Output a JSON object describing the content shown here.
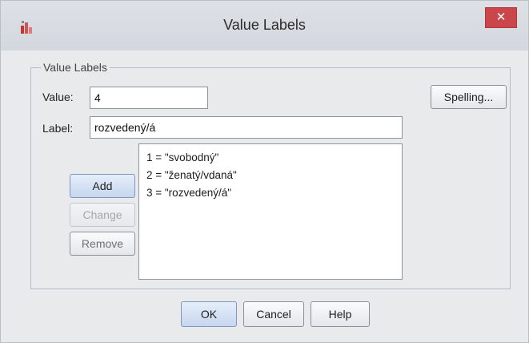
{
  "window": {
    "title": "Value Labels",
    "close_glyph": "✕"
  },
  "group": {
    "legend": "Value Labels"
  },
  "value_field": {
    "label": "Value:",
    "value": "4"
  },
  "label_field": {
    "label": "Label:",
    "value": "rozvedený/á"
  },
  "buttons": {
    "spelling": "Spelling...",
    "add": "Add",
    "change": "Change",
    "remove": "Remove",
    "ok": "OK",
    "cancel": "Cancel",
    "help": "Help"
  },
  "list": {
    "items": [
      "1 = \"svobodný\"",
      "2 = \"ženatý/vdaná\"",
      "3 = \"rozvedený/á\""
    ]
  },
  "colors": {
    "close": "#c9474a",
    "accent_button": "#c6d6ee"
  },
  "icons": {
    "app": "spss-value-labels-icon",
    "close": "close-icon"
  }
}
